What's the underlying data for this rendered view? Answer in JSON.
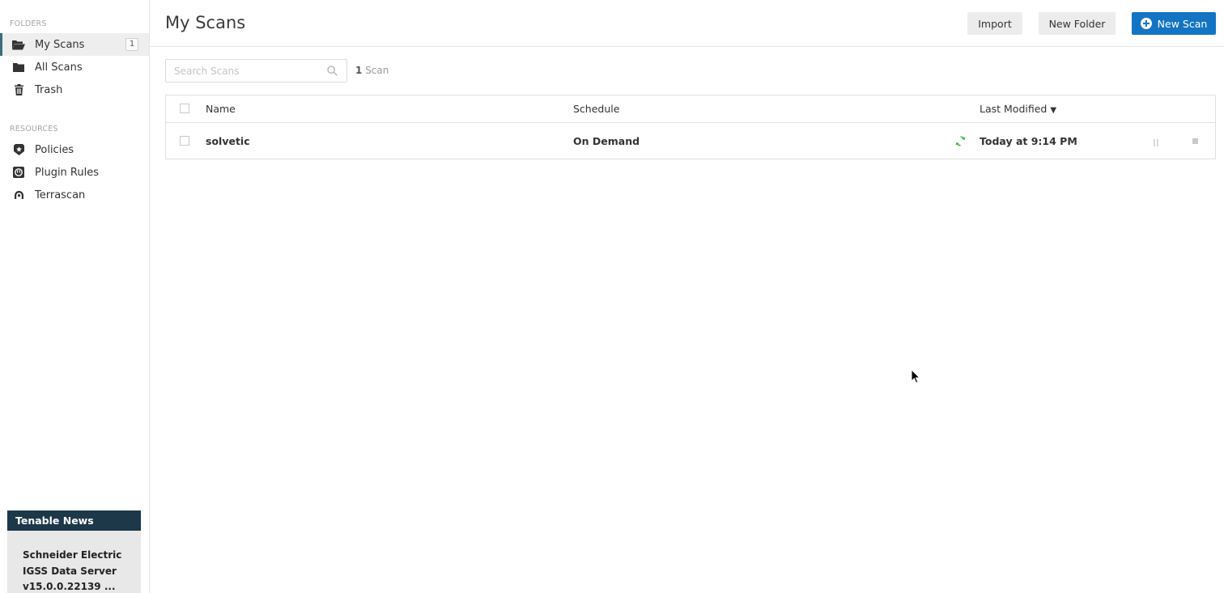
{
  "sidebar": {
    "folders_title": "FOLDERS",
    "folders": [
      {
        "label": "My Scans",
        "icon": "folder-open-icon",
        "badge": "1",
        "active": true
      },
      {
        "label": "All Scans",
        "icon": "folder-icon"
      },
      {
        "label": "Trash",
        "icon": "trash-icon"
      }
    ],
    "resources_title": "RESOURCES",
    "resources": [
      {
        "label": "Policies",
        "icon": "shield-icon"
      },
      {
        "label": "Plugin Rules",
        "icon": "plugin-rules-icon"
      },
      {
        "label": "Terrascan",
        "icon": "terrascan-icon"
      }
    ],
    "news": {
      "title": "Tenable News",
      "lines": [
        "Schneider Electric",
        "IGSS Data Server",
        "v15.0.0.22139 ..."
      ]
    }
  },
  "header": {
    "title": "My Scans",
    "import_label": "Import",
    "new_folder_label": "New Folder",
    "new_scan_label": "New Scan"
  },
  "search": {
    "placeholder": "Search Scans",
    "value": "",
    "count_number": "1",
    "count_label": "Scan"
  },
  "table": {
    "columns": {
      "name": "Name",
      "schedule": "Schedule",
      "last_modified": "Last Modified"
    },
    "sort_indicator": "▼",
    "rows": [
      {
        "name": "solvetic",
        "schedule": "On Demand",
        "status": "refresh-icon",
        "last_modified": "Today at 9:14 PM"
      }
    ]
  },
  "colors": {
    "primary_button": "#1474c4",
    "news_header": "#1c3849",
    "status_running": "#3cb54a",
    "active_indicator": "#3d6c7f"
  }
}
